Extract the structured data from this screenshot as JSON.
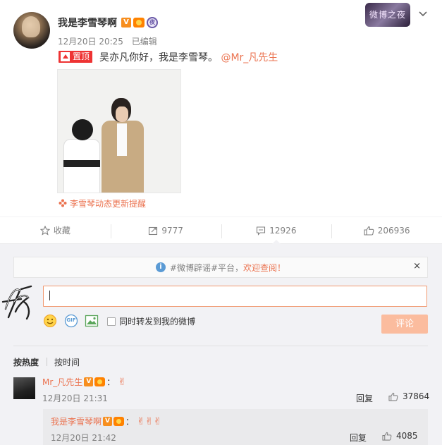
{
  "post": {
    "author": "我是李雪琴啊",
    "verified_label": "V",
    "badge_circle_label": "夜",
    "time": "12月20日 20:25",
    "edited_label": "已编辑",
    "event_logo_text": "微博之夜",
    "pin_label": "置顶",
    "text": "吴亦凡你好，我是李雪琴。",
    "mention": "@Mr_凡先生",
    "notice": "李雪琴动态更新提醒"
  },
  "actions": {
    "favorite_label": "收藏",
    "repost_count": "9777",
    "comment_count": "12926",
    "like_count": "206936"
  },
  "comment_box": {
    "rumor_prefix": "#微博辟谣#平台，",
    "rumor_highlight": "欢迎查阅！",
    "rumor_close": "×",
    "info_icon_label": "i",
    "repost_checkbox_label": "同时转发到我的微博",
    "submit_label": "评论",
    "gif_label": "GIF"
  },
  "sort": {
    "hot_label": "按热度",
    "time_label": "按时间"
  },
  "comments": [
    {
      "author": "Mr_凡先生",
      "verified_label": "V",
      "emoji": "✌",
      "time": "12月20日 21:31",
      "reply_label": "回复",
      "likes": "37864"
    },
    {
      "author": "我是李雪琴啊",
      "verified_label": "V",
      "emoji": "✌✌✌",
      "time": "12月20日 21:42",
      "reply_label": "回复",
      "likes": "4085"
    }
  ],
  "colors": {
    "accent": "#eb7350",
    "pin": "#ee3333",
    "submit_disabled": "#fbbc9e",
    "panel": "#f2f2f5"
  }
}
